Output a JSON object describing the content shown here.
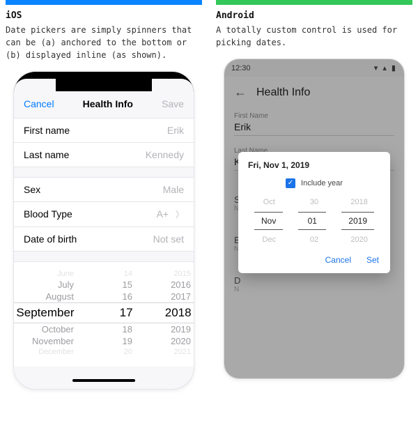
{
  "ios": {
    "col_title": "iOS",
    "col_desc": "Date pickers are simply spinners that can be (a) anchored to the bottom or (b) displayed inline (as shown).",
    "nav": {
      "cancel": "Cancel",
      "title": "Health Info",
      "save": "Save"
    },
    "rows": {
      "first_name": {
        "label": "First name",
        "value": "Erik"
      },
      "last_name": {
        "label": "Last name",
        "value": "Kennedy"
      },
      "sex": {
        "label": "Sex",
        "value": "Male"
      },
      "blood": {
        "label": "Blood Type",
        "value": "A+"
      },
      "dob": {
        "label": "Date of birth",
        "value": "Not set"
      }
    },
    "picker": {
      "r0": {
        "m": "June",
        "d": "14",
        "y": "2015"
      },
      "r1": {
        "m": "July",
        "d": "15",
        "y": "2016"
      },
      "r2": {
        "m": "August",
        "d": "16",
        "y": "2017"
      },
      "r3": {
        "m": "September",
        "d": "17",
        "y": "2018"
      },
      "r4": {
        "m": "October",
        "d": "18",
        "y": "2019"
      },
      "r5": {
        "m": "November",
        "d": "19",
        "y": "2020"
      },
      "r6": {
        "m": "December",
        "d": "20",
        "y": "2021"
      }
    }
  },
  "android": {
    "col_title": "Android",
    "col_desc": "A totally custom control is used for picking dates.",
    "status_time": "12:30",
    "toolbar": {
      "title": "Health Info"
    },
    "fields": {
      "first_name": {
        "label": "First Name",
        "value": "Erik"
      },
      "last_name": {
        "label": "Last Name",
        "value": "Kennedy"
      }
    },
    "stubs": {
      "s": {
        "a": "S",
        "b": "N"
      },
      "b": {
        "a": "B",
        "b": "N"
      },
      "d": {
        "a": "D",
        "b": "N"
      }
    },
    "dialog": {
      "title": "Fri, Nov 1, 2019",
      "include_label": "Include year",
      "rows": {
        "r0": {
          "m": "Oct",
          "d": "30",
          "y": "2018"
        },
        "r1": {
          "m": "Nov",
          "d": "01",
          "y": "2019"
        },
        "r2": {
          "m": "Dec",
          "d": "02",
          "y": "2020"
        }
      },
      "cancel": "Cancel",
      "set": "Set"
    }
  }
}
